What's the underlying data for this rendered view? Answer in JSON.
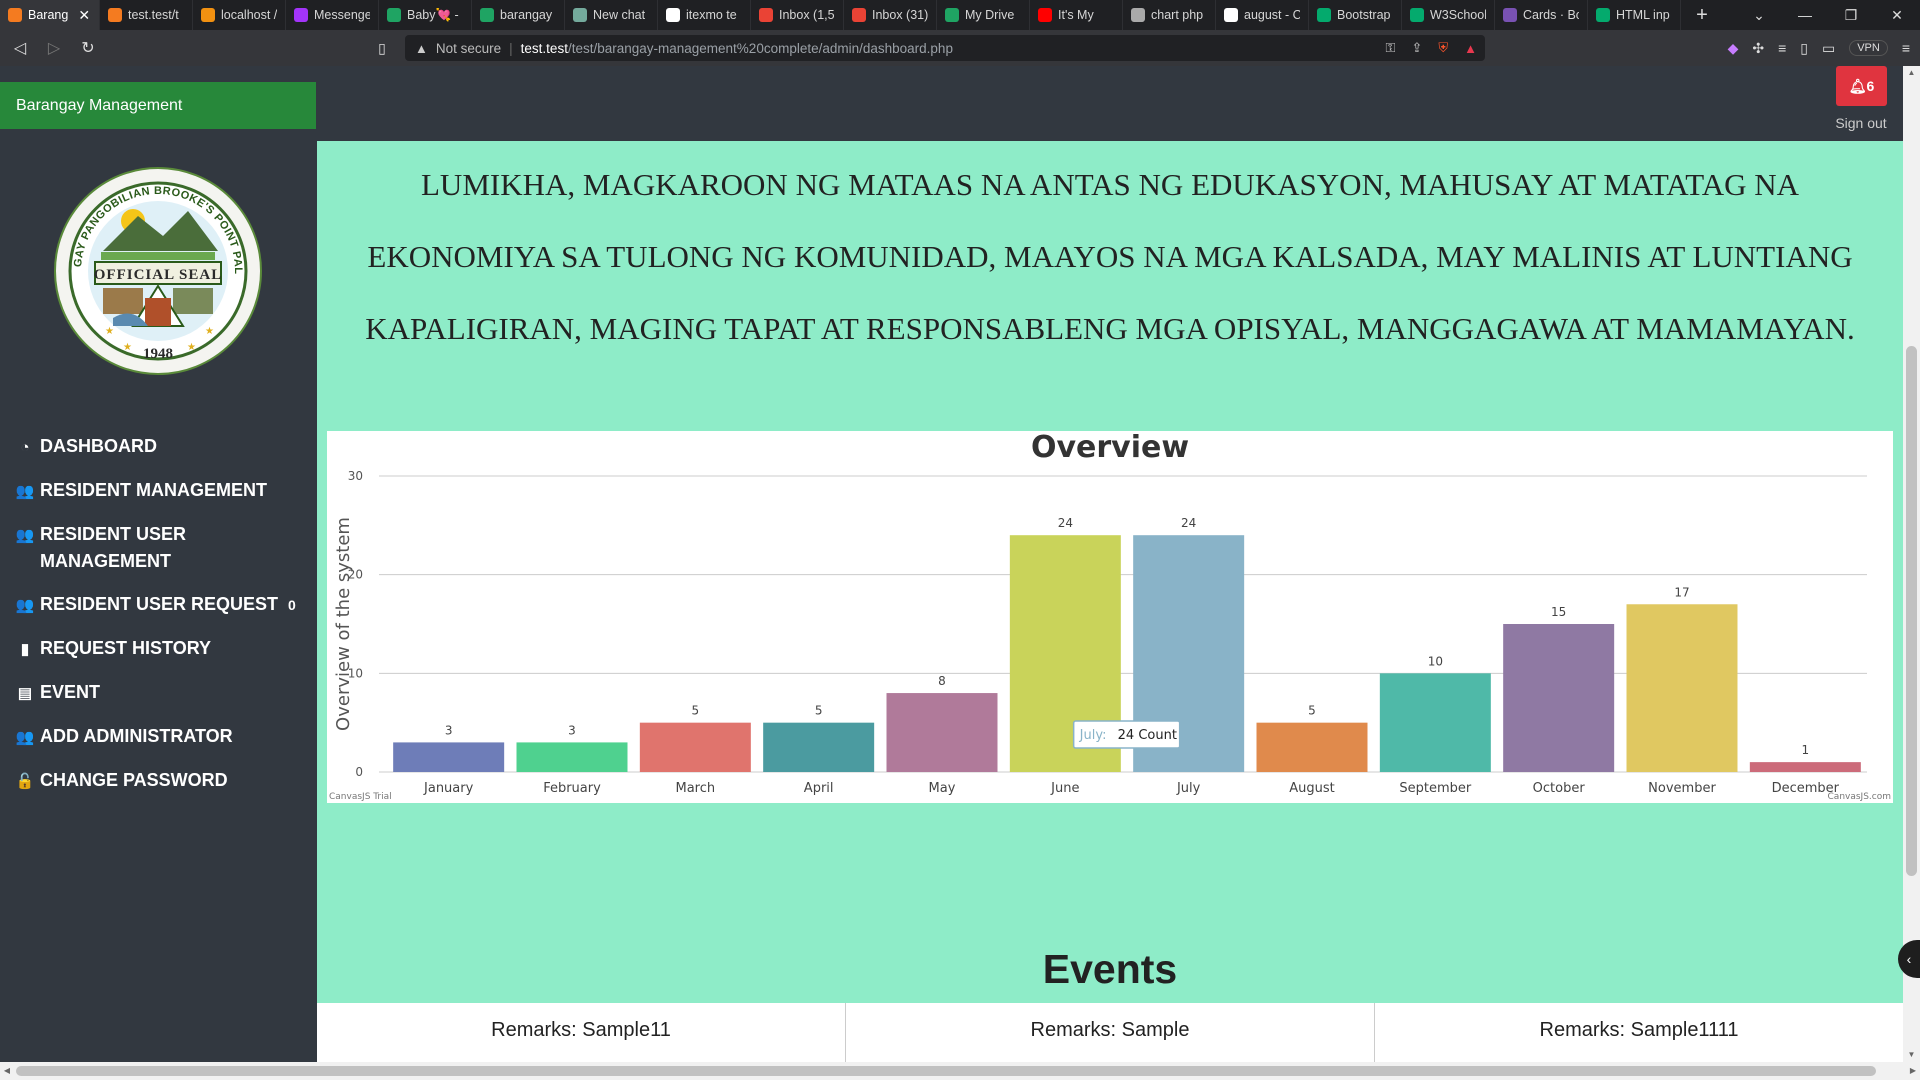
{
  "browser": {
    "tabs": [
      {
        "label": "Barang",
        "icon": "xampp-icon",
        "color": "#f47b20",
        "active": true
      },
      {
        "label": "test.test/t",
        "icon": "xampp-icon",
        "color": "#f47b20"
      },
      {
        "label": "localhost /",
        "icon": "phpmyadmin-icon",
        "color": "#f29111"
      },
      {
        "label": "Messenge",
        "icon": "messenger-icon",
        "color": "#a334fa"
      },
      {
        "label": "Baby💘 -",
        "icon": "drive-icon",
        "color": "#1fa463"
      },
      {
        "label": "barangay",
        "icon": "drive-icon",
        "color": "#1fa463"
      },
      {
        "label": "New chat",
        "icon": "chatgpt-icon",
        "color": "#74aa9c"
      },
      {
        "label": "itexmo te",
        "icon": "google-icon",
        "color": "#ffffff"
      },
      {
        "label": "Inbox (1,5",
        "icon": "gmail-icon",
        "color": "#ea4335"
      },
      {
        "label": "Inbox (31)",
        "icon": "gmail-icon",
        "color": "#ea4335"
      },
      {
        "label": "My Drive",
        "icon": "drive-icon",
        "color": "#1fa463"
      },
      {
        "label": "It's My",
        "icon": "youtube-icon",
        "color": "#ff0000"
      },
      {
        "label": "chart php",
        "icon": "globe-icon",
        "color": "#aaaaaa"
      },
      {
        "label": "august - C",
        "icon": "google-icon",
        "color": "#ffffff"
      },
      {
        "label": "Bootstrap",
        "icon": "w3schools-icon",
        "color": "#04aa6d"
      },
      {
        "label": "W3School",
        "icon": "w3schools-icon",
        "color": "#04aa6d"
      },
      {
        "label": "Cards · Bo",
        "icon": "bootstrap-icon",
        "color": "#7952b3"
      },
      {
        "label": "HTML inp",
        "icon": "w3schools-icon",
        "color": "#04aa6d"
      }
    ],
    "new_tab": "+",
    "security_label": "Not secure",
    "url_host": "test.test",
    "url_path": "/test/barangay-management%20complete/admin/dashboard.php",
    "vpn_label": "VPN"
  },
  "header": {
    "brand": "Barangay Management",
    "notification_count": "6",
    "signout": "Sign out"
  },
  "seal": {
    "top_text": "BARANGAY PANGOBILIAN BROOKE'S POINT PALAWAN",
    "banner": "OFFICIAL SEAL",
    "year": "1948"
  },
  "sidebar": {
    "items": [
      {
        "label": "DASHBOARD",
        "icon": "dashboard-icon",
        "glyph": "◔"
      },
      {
        "label": "RESIDENT MANAGEMENT",
        "icon": "users-icon",
        "glyph": "👥"
      },
      {
        "label": "RESIDENT USER MANAGEMENT",
        "icon": "users-icon",
        "glyph": "👥"
      },
      {
        "label": "RESIDENT USER REQUEST",
        "icon": "users-icon",
        "glyph": "👥",
        "badge": "0"
      },
      {
        "label": "REQUEST HISTORY",
        "icon": "file-icon",
        "glyph": "▮"
      },
      {
        "label": "EVENT",
        "icon": "calendar-icon",
        "glyph": "▤"
      },
      {
        "label": "ADD ADMINISTRATOR",
        "icon": "users-icon",
        "glyph": "👥"
      },
      {
        "label": "CHANGE PASSWORD",
        "icon": "unlock-icon",
        "glyph": "🔓"
      }
    ]
  },
  "mission": {
    "lines": [
      "LUMIKHA, MAGKAROON NG MATAAS NA ANTAS NG EDUKASYON, MAHUSAY AT MATATAG NA",
      "EKONOMIYA SA TULONG NG KOMUNIDAD, MAAYOS NA MGA KALSADA, MAY MALINIS AT LUNTIANG",
      "KAPALIGIRAN, MAGING TAPAT AT RESPONSABLENG MGA OPISYAL, MANGGAGAWA AT MAMAMAYAN."
    ]
  },
  "chart_data": {
    "type": "bar",
    "title": "Overview",
    "ylabel": "Overview of the system",
    "xlabel": "",
    "categories": [
      "January",
      "February",
      "March",
      "April",
      "May",
      "June",
      "July",
      "August",
      "September",
      "October",
      "November",
      "December"
    ],
    "values": [
      3,
      3,
      5,
      5,
      8,
      24,
      24,
      5,
      10,
      15,
      17,
      1
    ],
    "colors": [
      "#6e7db8",
      "#4fd18f",
      "#e0746d",
      "#4b9ba0",
      "#b07a9a",
      "#c9d35a",
      "#89b3c8",
      "#e08a4c",
      "#4fb9a8",
      "#8f79a3",
      "#e0c861",
      "#cc6b7a"
    ],
    "ylim": [
      0,
      30
    ],
    "yticks": [
      0,
      10,
      20,
      30
    ],
    "grid": true,
    "tooltip": {
      "category": "July:",
      "value": "24 Count"
    },
    "credits_left": "CanvasJS Trial",
    "credits_right": "CanvasJS.com"
  },
  "events": {
    "title": "Events",
    "cards": [
      {
        "remark": "Remarks: Sample11"
      },
      {
        "remark": "Remarks: Sample"
      },
      {
        "remark": "Remarks: Sample1111"
      }
    ]
  }
}
